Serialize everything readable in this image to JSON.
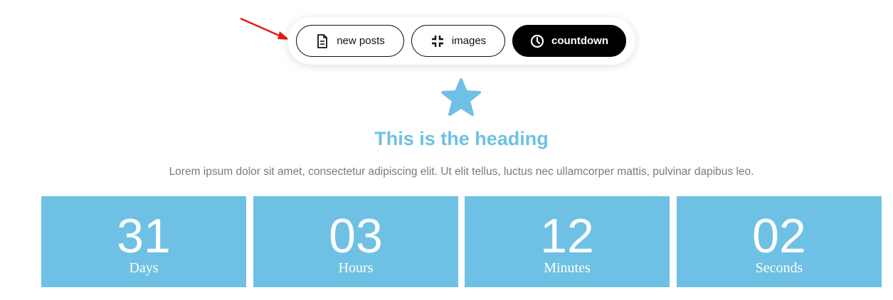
{
  "tabs": [
    {
      "label": "new posts",
      "icon": "document-icon",
      "active": false
    },
    {
      "label": "images",
      "icon": "shrink-icon",
      "active": false
    },
    {
      "label": "countdown",
      "icon": "clock-icon",
      "active": true
    }
  ],
  "content": {
    "icon": "star-icon",
    "heading": "This is the heading",
    "paragraph": "Lorem ipsum dolor sit amet, consectetur adipiscing elit. Ut elit tellus, luctus nec ullamcorper mattis, pulvinar dapibus leo."
  },
  "countdown": {
    "days": {
      "value": "31",
      "label": "Days"
    },
    "hours": {
      "value": "03",
      "label": "Hours"
    },
    "minutes": {
      "value": "12",
      "label": "Minutes"
    },
    "seconds": {
      "value": "02",
      "label": "Seconds"
    }
  },
  "colors": {
    "accent": "#6ec1e4",
    "annotation_arrow": "#e8191a",
    "active_tab": "#000000",
    "body_text": "#7a7a7a"
  }
}
